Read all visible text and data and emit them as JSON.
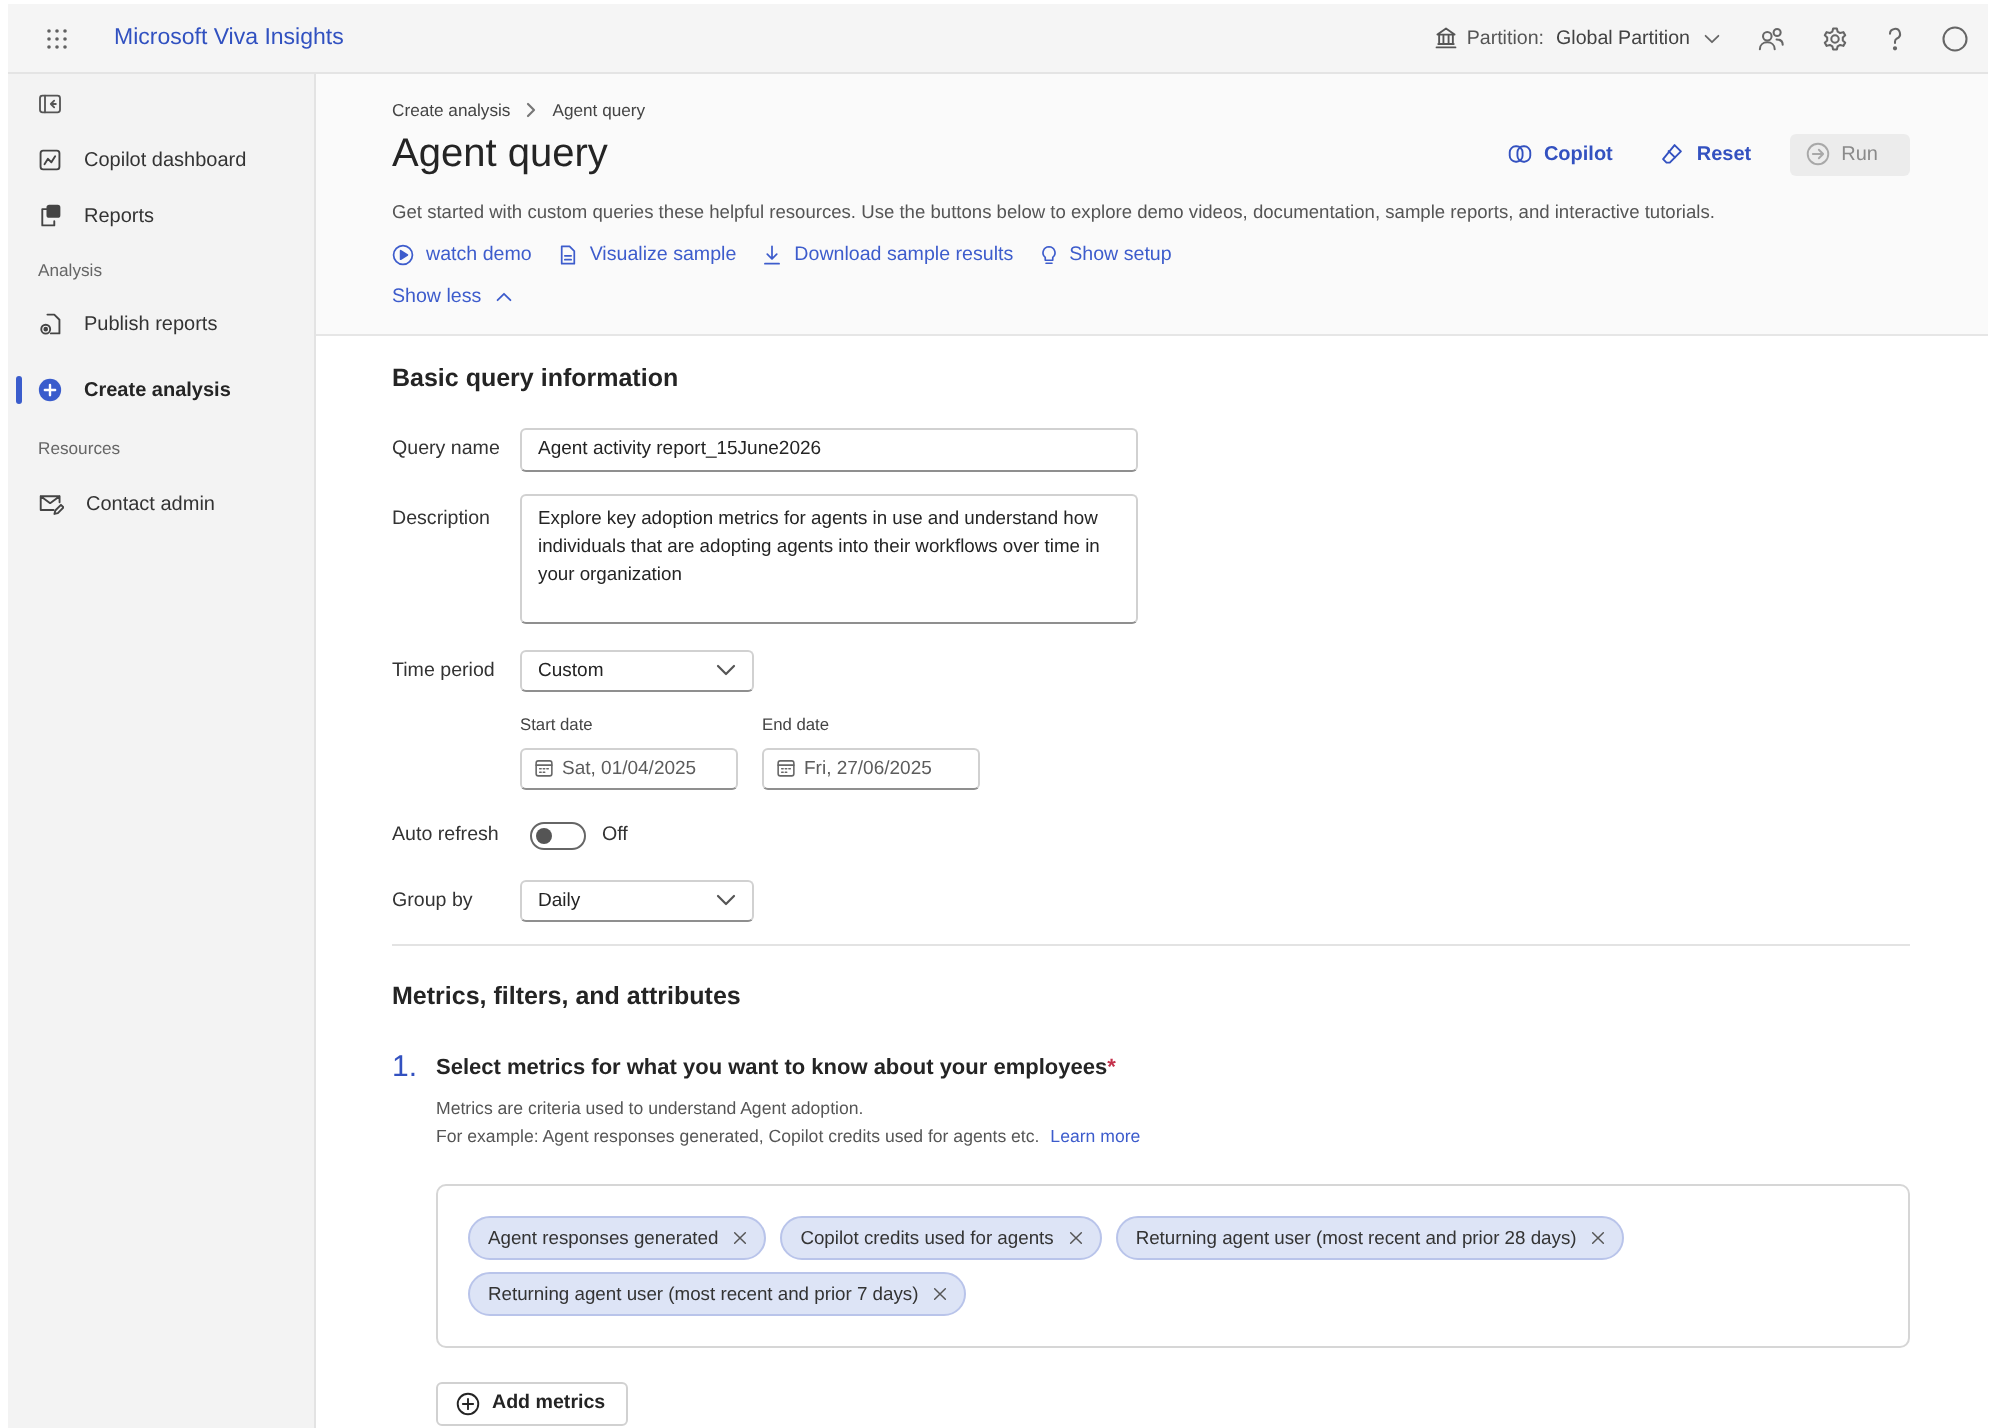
{
  "app_bar": {
    "title": "Microsoft Viva Insights",
    "partition_label": "Partition:",
    "partition_value": "Global Partition"
  },
  "sidebar": {
    "items": [
      {
        "kind": "link",
        "label": "Copilot dashboard",
        "selected": false
      },
      {
        "kind": "link",
        "label": "Reports",
        "selected": false
      },
      {
        "kind": "section",
        "label": "Analysis"
      },
      {
        "kind": "link",
        "label": "Publish reports",
        "selected": false
      },
      {
        "kind": "link",
        "label": "Create analysis",
        "selected": true
      },
      {
        "kind": "section",
        "label": "Resources"
      },
      {
        "kind": "link",
        "label": "Contact admin",
        "selected": false
      }
    ]
  },
  "page_header": {
    "breadcrumb": [
      "Create analysis",
      "Agent query"
    ],
    "title": "Agent query",
    "actions": [
      {
        "label": "Copilot",
        "disabled": false
      },
      {
        "label": "Reset",
        "disabled": false
      },
      {
        "label": "Run",
        "disabled": true
      }
    ],
    "intro": "Get started with custom queries these helpful resources. Use the buttons below to explore demo videos, documentation, sample reports, and interactive tutorials.",
    "resources": [
      "watch demo",
      "Visualize sample",
      "Download sample results",
      "Show setup"
    ],
    "toggle": {
      "label": "Show less",
      "expanded": true
    }
  },
  "basic_info": {
    "title": "Basic query information",
    "fields": [
      {
        "kind": "text",
        "label": "Query name",
        "value": "Agent activity report_15June2026"
      },
      {
        "kind": "textarea",
        "label": "Description",
        "value": "Explore key adoption metrics for agents in use and understand how individuals that are adopting agents into their workflows over time in your organization"
      },
      {
        "kind": "dropdown",
        "label": "Time period",
        "value": "Custom"
      },
      {
        "kind": "dates",
        "start_label": "Start date",
        "start_value": "Sat, 01/04/2025",
        "end_label": "End date",
        "end_value": "Fri, 27/06/2025"
      },
      {
        "kind": "toggle",
        "label": "Auto refresh",
        "on": false,
        "state_text": "Off"
      },
      {
        "kind": "dropdown",
        "label": "Group by",
        "value": "Daily"
      }
    ]
  },
  "metrics": {
    "title": "Metrics, filters, and attributes",
    "step": {
      "number": "1.",
      "heading": "Select metrics for what you want to know about your employees",
      "required_mark": "*",
      "lines": [
        "Metrics are criteria used to understand Agent adoption.",
        "For example: Agent responses generated, Copilot credits used for agents etc."
      ],
      "link": "Learn more",
      "chips": [
        "Agent responses generated",
        "Copilot credits used for agents",
        "Returning agent user (most recent and prior 28 days)",
        "Returning agent user (most recent and prior 7 days)"
      ],
      "add_button": "Add metrics"
    }
  }
}
